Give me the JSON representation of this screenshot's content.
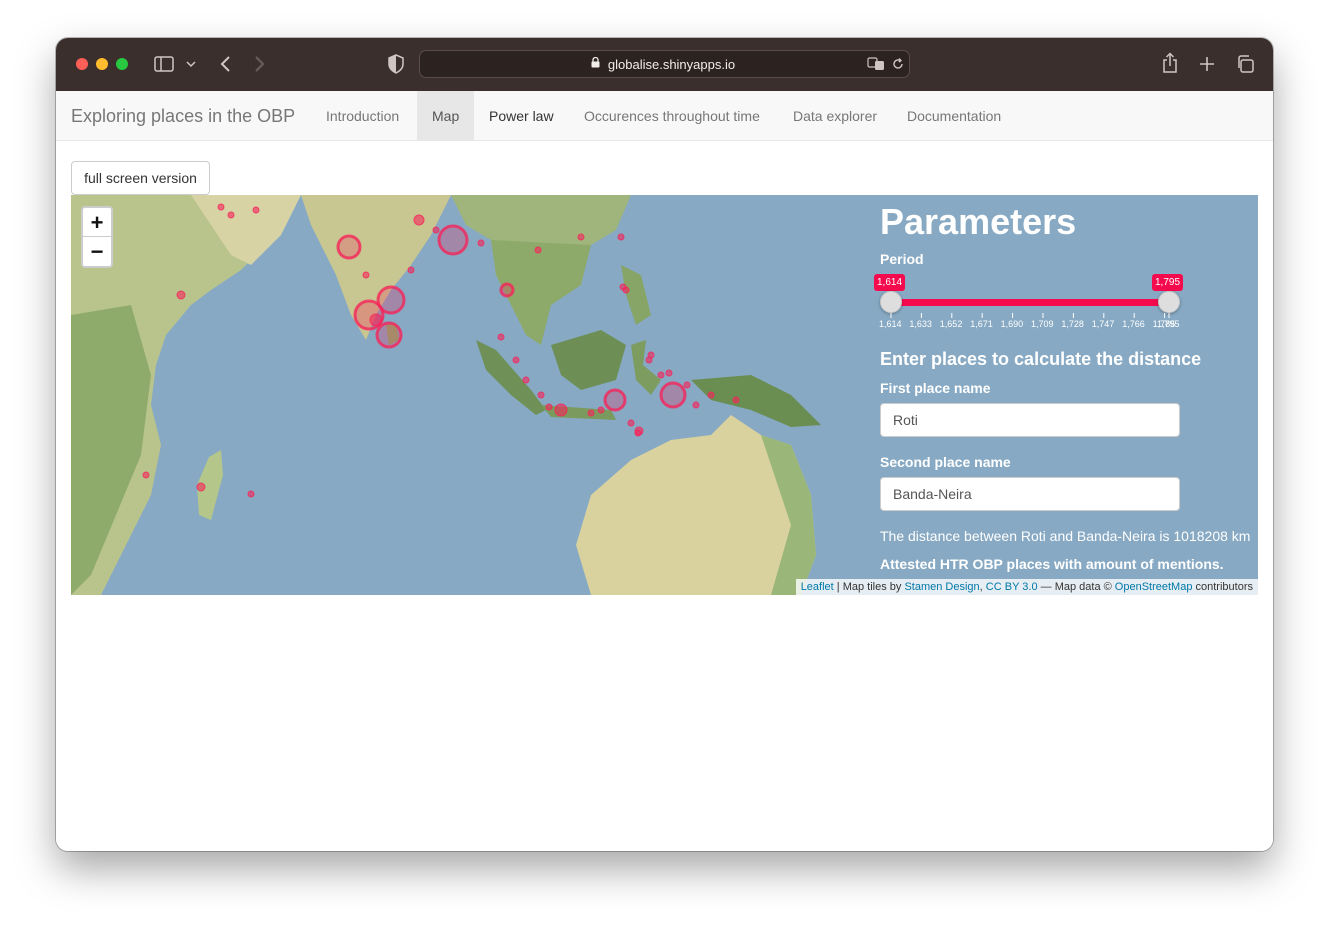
{
  "browser": {
    "url": "globalise.shinyapps.io",
    "icons": [
      "sidebar-icon",
      "chevron-down-icon",
      "back-icon",
      "forward-icon",
      "shield-icon",
      "lock-icon",
      "translate-icon",
      "reload-icon",
      "share-icon",
      "new-tab-icon",
      "tabs-overview-icon"
    ]
  },
  "navbar": {
    "brand": "Exploring places in the OBP",
    "tabs": [
      {
        "label": "Introduction"
      },
      {
        "label": "Map"
      },
      {
        "label": "Power law"
      },
      {
        "label": "Occurences throughout time"
      },
      {
        "label": "Data explorer"
      },
      {
        "label": "Documentation"
      }
    ],
    "active_tab": "Map"
  },
  "page": {
    "fullscreen_button": "full screen version"
  },
  "map": {
    "zoom_in": "+",
    "zoom_out": "−",
    "attribution": {
      "leaflet": "Leaflet",
      "sep1": "| Map tiles by",
      "stamen": "Stamen Design",
      "comma": ",",
      "license": "CC BY 3.0",
      "sep2": "— Map data ©",
      "osm": "OpenStreetMap",
      "contributors": "contributors"
    },
    "marker_color": "#f5245a",
    "ocean_color": "#87a9c3",
    "land_color": "#9bb37a"
  },
  "params": {
    "title": "Parameters",
    "period_label": "Period",
    "period_min_value": "1,614",
    "period_max_value": "1,795",
    "period_from": 1614,
    "period_to": 1795,
    "ticks": [
      "1,614",
      "1,633",
      "1,652",
      "1,671",
      "1,690",
      "1,709",
      "1,728",
      "1,747",
      "1,766",
      "1,785",
      "1,795"
    ],
    "distance_heading": "Enter places to calculate the distance",
    "first_label": "First place name",
    "first_value": "Roti",
    "second_label": "Second place name",
    "second_value": "Banda-Neira",
    "distance_text": "The distance between Roti and Banda-Neira is 1018208 km",
    "attested_text": "Attested HTR OBP places with amount of mentions."
  }
}
